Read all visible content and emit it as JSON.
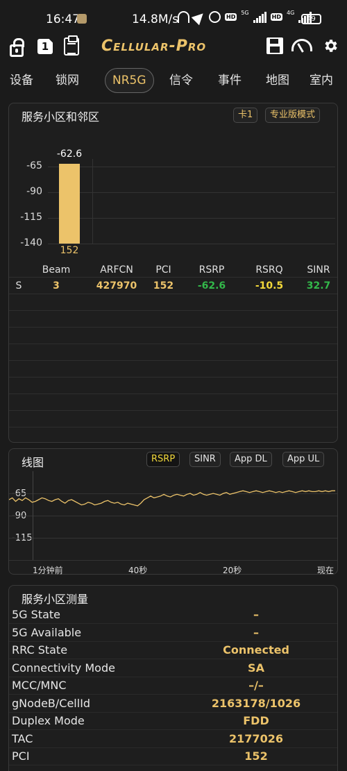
{
  "status_bar": {
    "time": "16:47",
    "speed": "14.8M/s",
    "net1": "5G",
    "net2": "4G",
    "hd": "HD",
    "battery": "49"
  },
  "toolbar": {
    "sim_label": "1",
    "brand": "Cellular-Pro"
  },
  "tabs": [
    {
      "label": "设备"
    },
    {
      "label": "锁网"
    },
    {
      "label": "NR5G"
    },
    {
      "label": "信令"
    },
    {
      "label": "事件"
    },
    {
      "label": "地图"
    },
    {
      "label": "室内"
    }
  ],
  "cells_panel": {
    "title": "服务小区和邻区",
    "card_chip": "卡1",
    "mode_chip": "专业版模式"
  },
  "chart_data": [
    {
      "type": "bar",
      "categories": [
        "152"
      ],
      "values": [
        -62.6
      ],
      "data_labels": [
        "-62.6"
      ],
      "ytick_labels": [
        "-65",
        "-90",
        "-115",
        "-140"
      ],
      "ylim": [
        -140,
        -50
      ],
      "color": "#ecc36a"
    },
    {
      "type": "line",
      "series": [
        {
          "name": "RSRP",
          "values": [
            -72,
            -70,
            -74,
            -71,
            -73,
            -70,
            -72,
            -75,
            -74,
            -72,
            -70,
            -71,
            -73,
            -74,
            -72,
            -71,
            -74,
            -76,
            -73,
            -72,
            -74,
            -76,
            -78,
            -77,
            -75,
            -76,
            -78,
            -77,
            -76,
            -74,
            -73,
            -75,
            -76,
            -75,
            -77,
            -78,
            -76,
            -77,
            -78,
            -79,
            -76,
            -72,
            -70,
            -68,
            -70,
            -69,
            -68,
            -66,
            -68,
            -69,
            -67,
            -66,
            -67,
            -68,
            -66,
            -65,
            -67,
            -66,
            -64,
            -66,
            -67,
            -66,
            -65,
            -66,
            -67,
            -65,
            -64,
            -66,
            -65,
            -64,
            -63,
            -62,
            -63,
            -64,
            -63,
            -62,
            -63,
            -64,
            -63,
            -62,
            -63,
            -64,
            -63,
            -64,
            -63,
            -62,
            -63,
            -64,
            -63,
            -62,
            -63,
            -62,
            -63,
            -63,
            -62,
            -63,
            -62,
            -63,
            -62,
            -62
          ]
        }
      ],
      "ytick_labels": [
        "-65",
        "-90",
        "-115"
      ],
      "ylim": [
        -130,
        -55
      ],
      "x_labels": [
        "1分钟前",
        "40秒",
        "20秒",
        "现在"
      ],
      "line_color": "#ecc36a"
    }
  ],
  "cell_table": {
    "headers": [
      "",
      "Beam",
      "ARFCN",
      "PCI",
      "RSRP",
      "RSRQ",
      "SINR"
    ],
    "rows": [
      {
        "type": "S",
        "beam": "3",
        "arfcn": "427970",
        "pci": "152",
        "rsrp": "-62.6",
        "rsrq": "-10.5",
        "sinr": "32.7"
      }
    ]
  },
  "line_panel": {
    "title": "线图",
    "chips": [
      "RSRP",
      "SINR",
      "App DL",
      "App UL"
    ]
  },
  "measure_panel": {
    "title": "服务小区测量",
    "items": [
      {
        "label": "5G State",
        "value": "–"
      },
      {
        "label": "5G Available",
        "value": "–"
      },
      {
        "label": "RRC State",
        "value": "Connected"
      },
      {
        "label": "Connectivity Mode",
        "value": "SA"
      },
      {
        "label": "MCC/MNC",
        "value": "–/–"
      },
      {
        "label": "gNodeB/CellId",
        "value": "2163178/1026"
      },
      {
        "label": "Duplex Mode",
        "value": "FDD"
      },
      {
        "label": "TAC",
        "value": "2177026"
      },
      {
        "label": "PCI",
        "value": "152"
      }
    ]
  }
}
